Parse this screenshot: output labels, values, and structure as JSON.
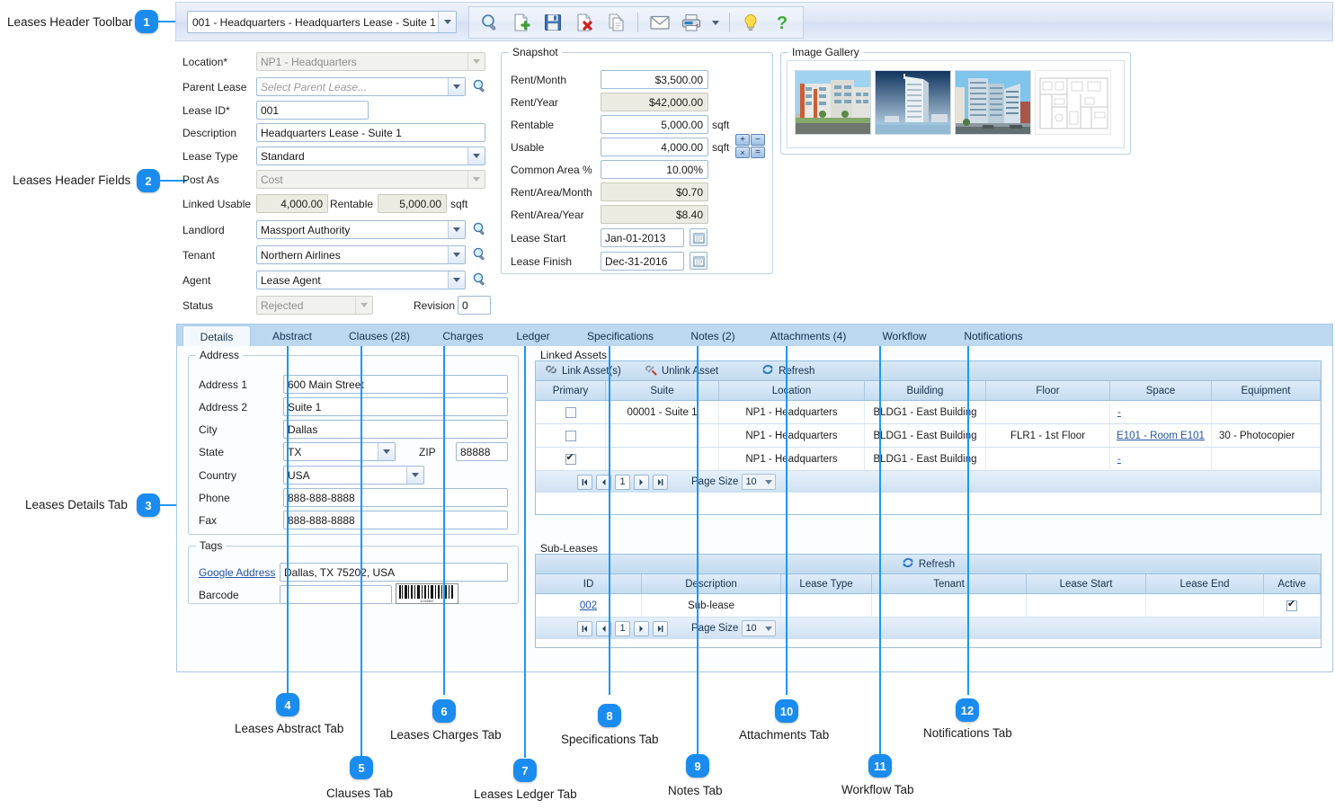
{
  "annotations": [
    {
      "n": "1",
      "label": "Leases Header Toolbar"
    },
    {
      "n": "2",
      "label": "Leases Header Fields"
    },
    {
      "n": "3",
      "label": "Leases Details Tab"
    },
    {
      "n": "4",
      "label": "Leases Abstract Tab"
    },
    {
      "n": "5",
      "label": "Clauses Tab"
    },
    {
      "n": "6",
      "label": "Leases Charges Tab"
    },
    {
      "n": "7",
      "label": "Leases Ledger Tab"
    },
    {
      "n": "8",
      "label": "Specifications Tab"
    },
    {
      "n": "9",
      "label": "Notes Tab"
    },
    {
      "n": "10",
      "label": "Attachments Tab"
    },
    {
      "n": "11",
      "label": "Workflow Tab"
    },
    {
      "n": "12",
      "label": "Notifications Tab"
    }
  ],
  "toolbar": {
    "lease_selector_value": "001 - Headquarters - Headquarters Lease - Suite 1",
    "icons": [
      {
        "name": "search-icon",
        "title": "Search"
      },
      {
        "name": "new-document-icon",
        "title": "New"
      },
      {
        "name": "save-icon",
        "title": "Save"
      },
      {
        "name": "delete-document-icon",
        "title": "Delete"
      },
      {
        "name": "copy-icon",
        "title": "Copy"
      },
      {
        "name": "email-icon",
        "title": "Email"
      },
      {
        "name": "print-icon",
        "title": "Print"
      },
      {
        "name": "print-dropdown-icon",
        "title": "Print options"
      },
      {
        "name": "lightbulb-icon",
        "title": "Tips"
      },
      {
        "name": "help-icon",
        "title": "Help"
      }
    ]
  },
  "header_fields": {
    "location": {
      "label": "Location*",
      "value": "NP1 - Headquarters"
    },
    "parent_lease": {
      "label": "Parent Lease",
      "placeholder": "Select Parent Lease...",
      "value": ""
    },
    "lease_id": {
      "label": "Lease ID*",
      "value": "001"
    },
    "description": {
      "label": "Description",
      "value": "Headquarters Lease - Suite 1"
    },
    "lease_type": {
      "label": "Lease Type",
      "value": "Standard"
    },
    "post_as": {
      "label": "Post As",
      "value": "Cost"
    },
    "linked_usable": {
      "label": "Linked Usable",
      "value": "4,000.00"
    },
    "rentable": {
      "label": "Rentable",
      "value": "5,000.00",
      "unit": "sqft"
    },
    "landlord": {
      "label": "Landlord",
      "value": "Massport Authority"
    },
    "tenant": {
      "label": "Tenant",
      "value": "Northern Airlines"
    },
    "agent": {
      "label": "Agent",
      "value": "Lease Agent"
    },
    "status": {
      "label": "Status",
      "value": "Rejected"
    },
    "revision": {
      "label": "Revision",
      "value": "0"
    }
  },
  "snapshot": {
    "title": "Snapshot",
    "rows": [
      {
        "label": "Rent/Month",
        "value": "$3,500.00",
        "readonly": false,
        "unit": ""
      },
      {
        "label": "Rent/Year",
        "value": "$42,000.00",
        "readonly": true,
        "unit": ""
      },
      {
        "label": "Rentable",
        "value": "5,000.00",
        "readonly": false,
        "unit": "sqft"
      },
      {
        "label": "Usable",
        "value": "4,000.00",
        "readonly": false,
        "unit": "sqft"
      },
      {
        "label": "Common Area %",
        "value": "10.00%",
        "readonly": false,
        "unit": ""
      },
      {
        "label": "Rent/Area/Month",
        "value": "$0.70",
        "readonly": true,
        "unit": ""
      },
      {
        "label": "Rent/Area/Year",
        "value": "$8.40",
        "readonly": true,
        "unit": ""
      }
    ],
    "lease_start": {
      "label": "Lease Start",
      "value": "Jan-01-2013"
    },
    "lease_finish": {
      "label": "Lease Finish",
      "value": "Dec-31-2016"
    },
    "calc_buttons": [
      "+",
      "−",
      "×",
      "="
    ]
  },
  "gallery": {
    "title": "Image Gallery",
    "items": [
      {
        "name": "thumbnail-building-1"
      },
      {
        "name": "thumbnail-building-2"
      },
      {
        "name": "thumbnail-building-3"
      },
      {
        "name": "thumbnail-floorplan"
      }
    ]
  },
  "tabs": [
    {
      "label": "Details",
      "active": true
    },
    {
      "label": "Abstract",
      "active": false
    },
    {
      "label": "Clauses (28)",
      "active": false
    },
    {
      "label": "Charges",
      "active": false
    },
    {
      "label": "Ledger",
      "active": false
    },
    {
      "label": "Specifications",
      "active": false
    },
    {
      "label": "Notes (2)",
      "active": false
    },
    {
      "label": "Attachments (4)",
      "active": false
    },
    {
      "label": "Workflow",
      "active": false
    },
    {
      "label": "Notifications",
      "active": false
    }
  ],
  "address": {
    "title": "Address",
    "fields": [
      {
        "label": "Address 1",
        "value": "600 Main Street"
      },
      {
        "label": "Address 2",
        "value": "Suite 1"
      },
      {
        "label": "City",
        "value": "Dallas"
      },
      {
        "label": "State",
        "value": "TX"
      },
      {
        "label": "ZIP",
        "value": "88888"
      },
      {
        "label": "Country",
        "value": "USA"
      },
      {
        "label": "Phone",
        "value": "888-888-8888"
      },
      {
        "label": "Fax",
        "value": "888-888-8888"
      }
    ]
  },
  "tags": {
    "title": "Tags",
    "google_address_label": "Google Address",
    "google_address_value": "Dallas, TX 75202, USA",
    "barcode_label": "Barcode",
    "barcode_value": "",
    "barcode_number": "1234567"
  },
  "linked_assets": {
    "title": "Linked Assets",
    "toolbar": [
      {
        "label": "Link Asset(s)",
        "icon": "link-icon"
      },
      {
        "label": "Unlink Asset",
        "icon": "unlink-icon"
      },
      {
        "label": "Refresh",
        "icon": "refresh-icon"
      }
    ],
    "columns": [
      "Primary",
      "Suite",
      "Location",
      "Building",
      "Floor",
      "Space",
      "Equipment"
    ],
    "rows": [
      {
        "primary": false,
        "suite": "00001 - Suite 1",
        "location": "NP1 - Headquarters",
        "building": "BLDG1 - East Building",
        "floor": "",
        "space": "-",
        "equipment": ""
      },
      {
        "primary": false,
        "suite": "",
        "location": "NP1 - Headquarters",
        "building": "BLDG1 - East Building",
        "floor": "FLR1 - 1st Floor",
        "space": "E101 - Room E101",
        "equipment": "30 - Photocopier"
      },
      {
        "primary": true,
        "suite": "",
        "location": "NP1 - Headquarters",
        "building": "BLDG1 - East Building",
        "floor": "",
        "space": "-",
        "equipment": ""
      }
    ],
    "pager": {
      "page": "1",
      "page_size_label": "Page Size",
      "page_size": "10"
    }
  },
  "sub_leases": {
    "title": "Sub-Leases",
    "toolbar": [
      {
        "label": "Refresh",
        "icon": "refresh-icon"
      }
    ],
    "columns": [
      "ID",
      "Description",
      "Lease Type",
      "Tenant",
      "Lease Start",
      "Lease End",
      "Active"
    ],
    "rows": [
      {
        "id": "002",
        "description": "Sub-lease",
        "lease_type": "",
        "tenant": "",
        "lease_start": "",
        "lease_end": "",
        "active": true
      }
    ],
    "pager": {
      "page": "1",
      "page_size_label": "Page Size",
      "page_size": "10"
    }
  },
  "colors": {
    "accent": "#1a8cf0",
    "toolbar_bg": "#dfe7f6",
    "tab_strip": "#bcd8f0",
    "link": "#2154a6"
  }
}
